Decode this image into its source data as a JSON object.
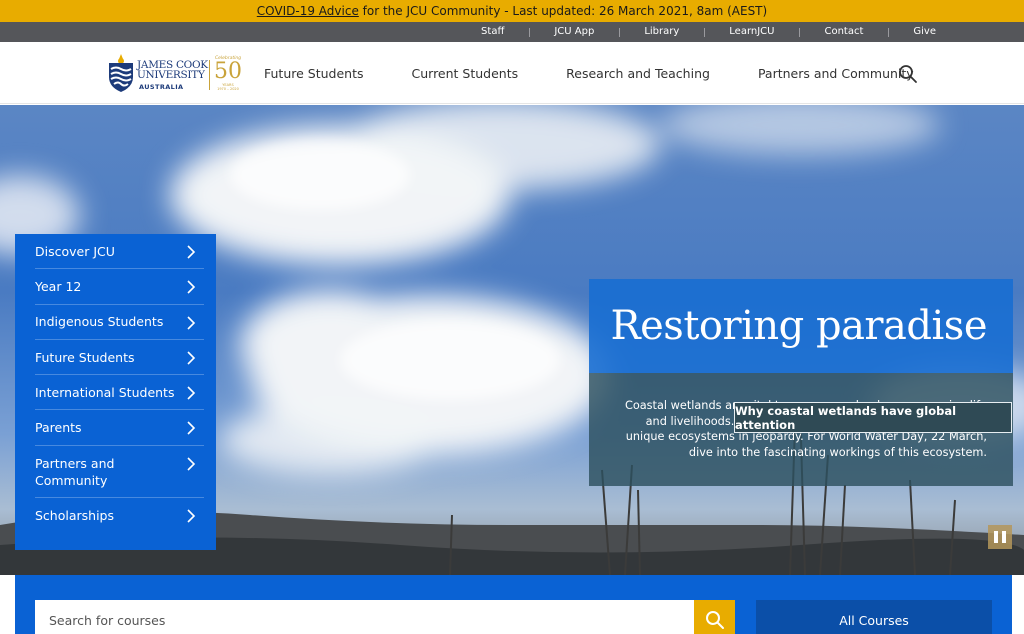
{
  "alert": {
    "link_text": "COVID-19 Advice",
    "text": " for the JCU Community - Last updated: 26 March 2021, 8am (AEST)"
  },
  "utility_nav": [
    "Staff",
    "JCU App",
    "Library",
    "LearnJCU",
    "Contact",
    "Give"
  ],
  "logo": {
    "line1": "JAMES COOK",
    "line2": "UNIVERSITY",
    "line3": "AUSTRALIA",
    "celebrating": "Celebrating",
    "number": "50",
    "years": "YEARS",
    "range": "1970 – 2020"
  },
  "main_nav": [
    "Future Students",
    "Current Students",
    "Research and Teaching",
    "Partners and Community"
  ],
  "side_menu": [
    {
      "label": "Discover JCU"
    },
    {
      "label": "Year 12"
    },
    {
      "label": "Indigenous Students"
    },
    {
      "label": "Future Students"
    },
    {
      "label": "International Students"
    },
    {
      "label": "Parents"
    },
    {
      "label": "Partners and Community"
    },
    {
      "label": "Scholarships"
    }
  ],
  "story": {
    "title": "Restoring paradise",
    "description": "Coastal wetlands are vital to seascapes, landscapes, marine life and livelihoods. However, urban development has put these unique ecosystems in jeopardy. For World Water Day, 22 March, dive into the fascinating workings of this ecosystem.",
    "cta": "Why coastal wetlands have global attention"
  },
  "course_search": {
    "placeholder": "Search for courses",
    "all_courses": "All Courses"
  },
  "colors": {
    "alert": "#e8ac00",
    "utility_bar": "#55565a",
    "brand_blue": "#0a62d4",
    "navy": "#1d3b7a",
    "gold": "#c9a33a"
  }
}
